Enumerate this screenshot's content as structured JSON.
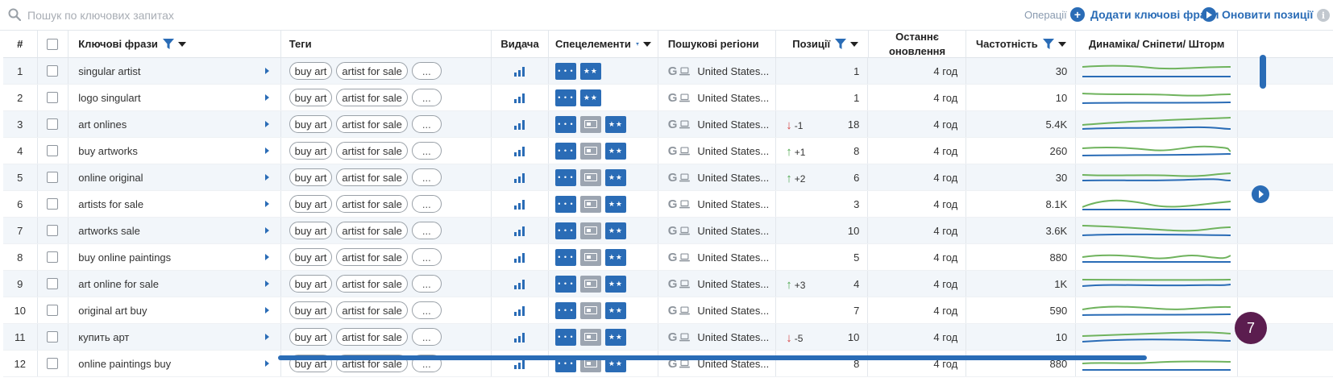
{
  "search": {
    "placeholder": "Пошук по ключових запитах"
  },
  "toolbar": {
    "operations_label": "Операції",
    "add_keywords_label": "Додати ключові фрази",
    "update_positions_label": "Оновити позиції"
  },
  "columns": {
    "num": "#",
    "keywords": "Ключові фрази",
    "tags": "Теги",
    "serp": "Видача",
    "special": "Спецелементи",
    "regions": "Пошукові регіони",
    "positions": "Позиції",
    "last_update_line1": "Останнє",
    "last_update_line2": "оновлення",
    "frequency": "Частотність",
    "dynamics": "Динаміка/ Сніпети/ Шторм"
  },
  "rows": [
    {
      "num": "1",
      "keyword": "singular artist",
      "tags": [
        "buy art",
        "artist for sale",
        "..."
      ],
      "special": [
        "dots",
        "stars"
      ],
      "region": "United States...",
      "delta": "",
      "delta_dir": "",
      "position": "1",
      "updated": "4 год",
      "frequency": "30"
    },
    {
      "num": "2",
      "keyword": "logo singulart",
      "tags": [
        "buy art",
        "artist for sale",
        "..."
      ],
      "special": [
        "dots",
        "stars"
      ],
      "region": "United States...",
      "delta": "",
      "delta_dir": "",
      "position": "1",
      "updated": "4 год",
      "frequency": "10"
    },
    {
      "num": "3",
      "keyword": "art onlines",
      "tags": [
        "buy art",
        "artist for sale",
        "..."
      ],
      "special": [
        "dots",
        "snippet",
        "stars"
      ],
      "region": "United States...",
      "delta": "-1",
      "delta_dir": "down",
      "position": "18",
      "updated": "4 год",
      "frequency": "5.4K"
    },
    {
      "num": "4",
      "keyword": "buy artworks",
      "tags": [
        "buy art",
        "artist for sale",
        "..."
      ],
      "special": [
        "dots",
        "snippet",
        "stars"
      ],
      "region": "United States...",
      "delta": "+1",
      "delta_dir": "up",
      "position": "8",
      "updated": "4 год",
      "frequency": "260"
    },
    {
      "num": "5",
      "keyword": "online original",
      "tags": [
        "buy art",
        "artist for sale",
        "..."
      ],
      "special": [
        "dots",
        "snippet",
        "stars"
      ],
      "region": "United States...",
      "delta": "+2",
      "delta_dir": "up",
      "position": "6",
      "updated": "4 год",
      "frequency": "30"
    },
    {
      "num": "6",
      "keyword": "artists for sale",
      "tags": [
        "buy art",
        "artist for sale",
        "..."
      ],
      "special": [
        "dots",
        "snippet",
        "stars"
      ],
      "region": "United States...",
      "delta": "",
      "delta_dir": "",
      "position": "3",
      "updated": "4 год",
      "frequency": "8.1K"
    },
    {
      "num": "7",
      "keyword": "artworks sale",
      "tags": [
        "buy art",
        "artist for sale",
        "..."
      ],
      "special": [
        "dots",
        "snippet",
        "stars"
      ],
      "region": "United States...",
      "delta": "",
      "delta_dir": "",
      "position": "10",
      "updated": "4 год",
      "frequency": "3.6K"
    },
    {
      "num": "8",
      "keyword": "buy online paintings",
      "tags": [
        "buy art",
        "artist for sale",
        "..."
      ],
      "special": [
        "dots",
        "snippet",
        "stars"
      ],
      "region": "United States...",
      "delta": "",
      "delta_dir": "",
      "position": "5",
      "updated": "4 год",
      "frequency": "880"
    },
    {
      "num": "9",
      "keyword": "art online for sale",
      "tags": [
        "buy art",
        "artist for sale",
        "..."
      ],
      "special": [
        "dots",
        "snippet",
        "stars"
      ],
      "region": "United States...",
      "delta": "+3",
      "delta_dir": "up",
      "position": "4",
      "updated": "4 год",
      "frequency": "1K"
    },
    {
      "num": "10",
      "keyword": "original art buy",
      "tags": [
        "buy art",
        "artist for sale",
        "..."
      ],
      "special": [
        "dots",
        "snippet",
        "stars"
      ],
      "region": "United States...",
      "delta": "",
      "delta_dir": "",
      "position": "7",
      "updated": "4 год",
      "frequency": "590"
    },
    {
      "num": "11",
      "keyword": "купить арт",
      "tags": [
        "buy art",
        "artist for sale",
        "..."
      ],
      "special": [
        "dots",
        "snippet",
        "stars"
      ],
      "region": "United States...",
      "delta": "-5",
      "delta_dir": "down",
      "position": "10",
      "updated": "4 год",
      "frequency": "10"
    },
    {
      "num": "12",
      "keyword": "online paintings buy",
      "tags": [
        "buy art",
        "artist for sale",
        "..."
      ],
      "special": [
        "dots",
        "snippet",
        "stars"
      ],
      "region": "United States...",
      "delta": "",
      "delta_dir": "",
      "position": "8",
      "updated": "4 год",
      "frequency": "880"
    }
  ],
  "badge": {
    "count": "7"
  },
  "colors": {
    "accent": "#2a6cb6",
    "spark_green": "#6fb35d",
    "spark_blue": "#2a6cb6",
    "delta_down": "#d64545",
    "delta_up": "#4ea84e",
    "badge": "#5b1d4f"
  }
}
